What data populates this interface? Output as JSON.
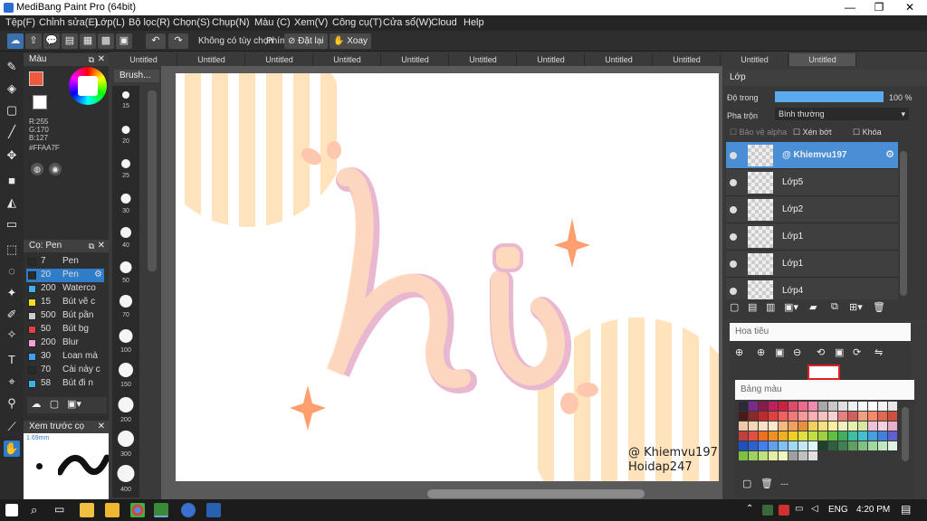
{
  "window": {
    "title": "MediBang Paint Pro (64bit)",
    "min": "—",
    "max": "❐",
    "close": "✕"
  },
  "menu": [
    "Tệp(F)",
    "Chỉnh sửa(E)",
    "Lớp(L)",
    "Bộ lọc(R)",
    "Chọn(S)",
    "Chụp(N)",
    "Màu (C)",
    "Xem(V)",
    "Công cụ(T)",
    "Cửa sổ(W)",
    "Cloud",
    "Help"
  ],
  "toolbar": {
    "no_options": "Không có tùy chọn",
    "keys_label": "Phím",
    "reset_label": "Đặt lại",
    "rotate_label": "Xoay"
  },
  "tabs": [
    "Untitled",
    "Untitled",
    "Untitled",
    "Untitled",
    "Untitled",
    "Untitled",
    "Untitled",
    "Untitled",
    "Untitled",
    "Untitled",
    "Untitled"
  ],
  "color_panel": {
    "title": "Màu",
    "r": "R:255",
    "g": "G:170",
    "b": "B:127",
    "hex": "#FFAA7F",
    "fg_color": "#f05a3c"
  },
  "brush_panel": {
    "title": "Cọ: Pen",
    "items": [
      {
        "size": "7",
        "name": "Pen",
        "color": "#2a2a2a"
      },
      {
        "size": "20",
        "name": "Pen",
        "color": "#2a2a2a"
      },
      {
        "size": "200",
        "name": "Waterco",
        "color": "#3fb0e8"
      },
      {
        "size": "15",
        "name": "Bút vẽ c",
        "color": "#f0e020"
      },
      {
        "size": "500",
        "name": "Bút pần",
        "color": "#cccccc"
      },
      {
        "size": "50",
        "name": "Bút bg",
        "color": "#e04040"
      },
      {
        "size": "200",
        "name": "Blur",
        "color": "#f5a0d8"
      },
      {
        "size": "30",
        "name": "Loan mà",
        "color": "#40a0f0"
      },
      {
        "size": "70",
        "name": "Cài này c",
        "color": "#2a2a2a"
      },
      {
        "size": "58",
        "name": "Bút đi n",
        "color": "#3fb0e8"
      }
    ]
  },
  "preview": {
    "title": "Xem trước cọ",
    "size": "1.69mm"
  },
  "brush_sizes": {
    "title": "Brush...",
    "sizes": [
      "15",
      "20",
      "25",
      "30",
      "40",
      "50",
      "70",
      "100",
      "150",
      "200",
      "300",
      "400"
    ]
  },
  "layers": {
    "title": "Lớp",
    "opacity_label": "Độ trong",
    "opacity_value": "100 %",
    "opacity": 1.0,
    "blend_label": "Pha trộn",
    "blend_value": "Bình thường",
    "protect_alpha": "Bảo vệ alpha",
    "clipping": "Xén bớt",
    "lock": "Khóa",
    "items": [
      {
        "name": "@ Khiemvu197",
        "selected": true
      },
      {
        "name": "Lớp5",
        "selected": false
      },
      {
        "name": "Lớp2",
        "selected": false
      },
      {
        "name": "Lớp1",
        "selected": false
      },
      {
        "name": "Lớp1",
        "selected": false
      },
      {
        "name": "Lớp4",
        "selected": false
      }
    ]
  },
  "navigator": {
    "title": "Hoa tiêu"
  },
  "swatches": {
    "title": "Bảng màu",
    "footer": "---",
    "colors": [
      "#2a2a3a",
      "#7a2a8a",
      "#8a1a4a",
      "#c02060",
      "#d02040",
      "#e04a6a",
      "#f06a8a",
      "#f48ab0",
      "#a8a8a8",
      "#c8c8c8",
      "#e0e0e0",
      "#f0f0f0",
      "#fafafa",
      "#ffffff",
      "#f4f4f4",
      "#e8e8e8",
      "#4a1a1a",
      "#8a2a2a",
      "#c02a2a",
      "#e04040",
      "#f06060",
      "#f07a7a",
      "#f59a9a",
      "#fab0b0",
      "#f4c0c0",
      "#f8d0d0",
      "#e88080",
      "#d06060",
      "#f0a080",
      "#f48a6a",
      "#e06a50",
      "#d05040",
      "#f0c8a8",
      "#f5d6b8",
      "#fae0c8",
      "#fde8d0",
      "#f8b880",
      "#f0a060",
      "#e89040",
      "#f4d060",
      "#f8e080",
      "#fcf0a0",
      "#f0f0c0",
      "#e8f0b0",
      "#d8e8a0",
      "#f0c0d8",
      "#f8d0e0",
      "#e8b0c8",
      "#c04040",
      "#e05040",
      "#f07020",
      "#f09020",
      "#f0b020",
      "#f0d020",
      "#e0e040",
      "#c0e040",
      "#a0d040",
      "#60c040",
      "#40b060",
      "#40c0a0",
      "#40c0d0",
      "#40a0e0",
      "#4080e0",
      "#6060d0",
      "#2050c0",
      "#3060d0",
      "#4080f0",
      "#60a0f0",
      "#80c0f8",
      "#a0d8f8",
      "#c0e8f8",
      "#e0f4fc",
      "#204030",
      "#306040",
      "#408050",
      "#60a060",
      "#80c080",
      "#a0d8a0",
      "#c0e8c0",
      "#e0f4e0",
      "#80c040",
      "#a0d060",
      "#c0e080",
      "#e0f0a0",
      "#f0f8c0",
      "#a0a0a0",
      "#c0c0c0",
      "#e0e0e0"
    ]
  },
  "canvas": {
    "signature_1": "@ Khiemvu197",
    "signature_2": "Hoidap247"
  },
  "taskbar": {
    "lang": "ENG",
    "time": "4:20 PM"
  }
}
